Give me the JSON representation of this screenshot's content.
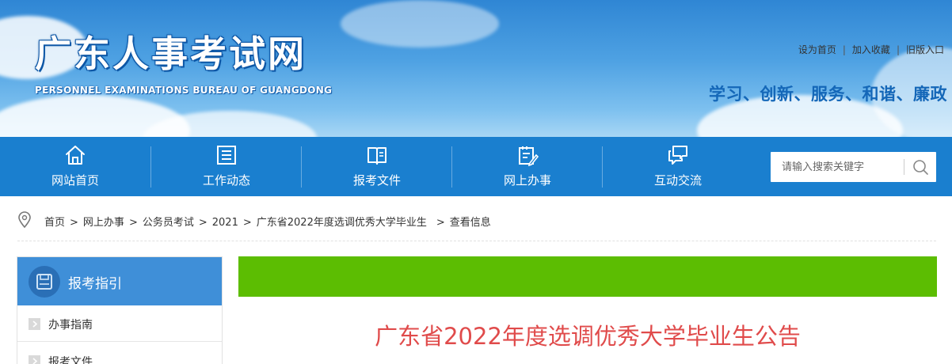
{
  "header": {
    "title": "广东人事考试网",
    "subtitle": "PERSONNEL EXAMINATIONS BUREAU OF GUANGDONG",
    "top_links": [
      "设为首页",
      "加入收藏",
      "旧版入口"
    ],
    "slogan": "学习、创新、服务、和谐、廉政"
  },
  "nav": {
    "items": [
      {
        "label": "网站首页",
        "icon": "home-icon"
      },
      {
        "label": "工作动态",
        "icon": "news-icon"
      },
      {
        "label": "报考文件",
        "icon": "book-icon"
      },
      {
        "label": "网上办事",
        "icon": "edit-document-icon"
      },
      {
        "label": "互动交流",
        "icon": "chat-icon"
      }
    ],
    "search_placeholder": "请输入搜索关键字"
  },
  "breadcrumb": [
    "首页",
    "网上办事",
    "公务员考试",
    "2021",
    "广东省2022年度选调优秀大学毕业生",
    "查看信息"
  ],
  "sidebar": {
    "title": "报考指引",
    "items": [
      "办事指南",
      "报考文件"
    ]
  },
  "main": {
    "article_title": "广东省2022年度选调优秀大学毕业生公告"
  },
  "colors": {
    "nav_bg": "#1a7fcf",
    "green_bar": "#5cbd02",
    "title_red": "#e04b4b",
    "slogan_blue": "#1467b8",
    "sidebar_head": "#3f8fd8"
  }
}
